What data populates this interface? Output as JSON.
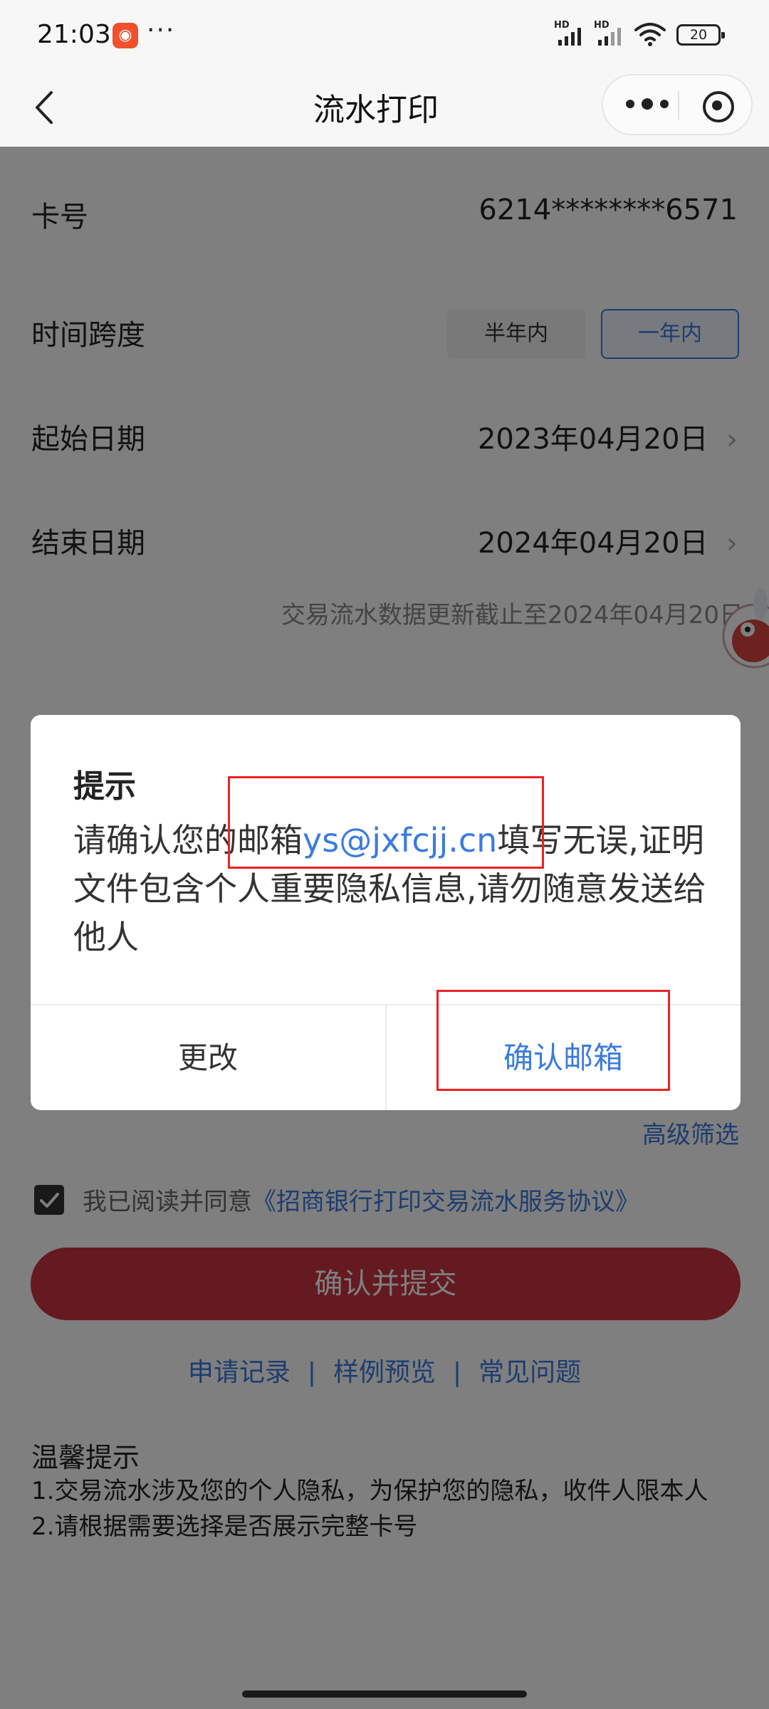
{
  "status_bar": {
    "time": "21:03",
    "app_icon": "record-icon",
    "more": "···",
    "hd1": "HD",
    "hd2": "HD",
    "battery": "20"
  },
  "nav": {
    "title": "流水打印",
    "back_icon": "chevron-left-icon",
    "more_icon": "more-dots-icon",
    "close_icon": "target-circle-icon"
  },
  "form": {
    "card_label": "卡号",
    "card_value": "6214********6571",
    "span_label": "时间跨度",
    "span_options": [
      "半年内",
      "一年内"
    ],
    "span_selected": "一年内",
    "start_label": "起始日期",
    "start_value": "2023年04月20日",
    "end_label": "结束日期",
    "end_value": "2024年04月20日",
    "update_note": "交易流水数据更新截止至2024年04月20日"
  },
  "advanced_filter": "高级筛选",
  "agreement": {
    "checked": true,
    "text": "我已阅读并同意",
    "link": "《招商银行打印交易流水服务协议》"
  },
  "submit_label": "确认并提交",
  "links": [
    "申请记录",
    "样例预览",
    "常见问题"
  ],
  "links_separator": "|",
  "tips": {
    "title": "温馨提示",
    "items": [
      "1.交易流水涉及您的个人隐私，为保护您的隐私，收件人限本人",
      "2.请根据需要选择是否展示完整卡号"
    ]
  },
  "dialog": {
    "title": "提示",
    "body_prefix": "请确认您的邮箱",
    "email": "ys@jxfcjj.cn",
    "body_suffix": "填写无误,证明文件包含个人重要隐私信息,请勿随意发送给他人",
    "cancel_label": "更改",
    "confirm_label": "确认邮箱"
  },
  "colors": {
    "accent": "#3a7be0",
    "submit": "#c83440",
    "annotation": "#ee2222"
  }
}
